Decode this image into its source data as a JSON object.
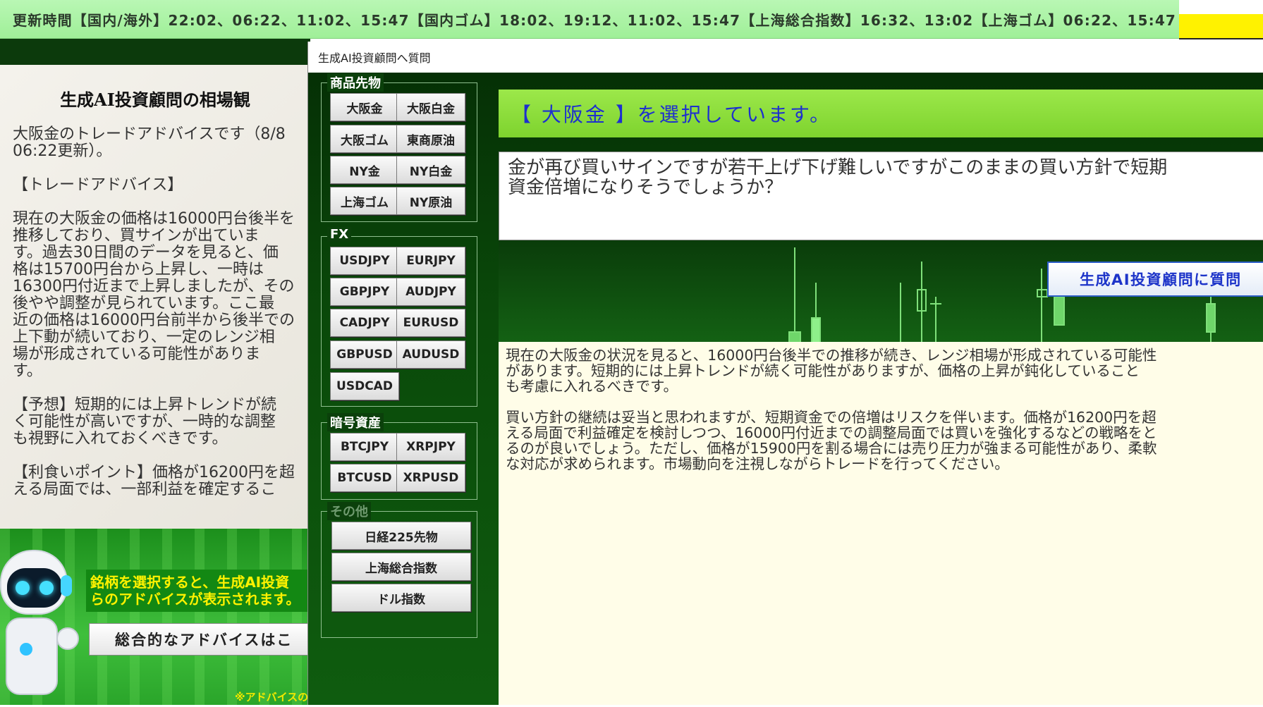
{
  "ticker": {
    "text": "更新時間【国内/海外】22:02、06:22、11:02、15:47【国内ゴム】18:02、19:12、11:02、15:47【上海総合指数】16:32、13:02【上海ゴム】06:22、15:47"
  },
  "left_panel": {
    "title": "生成AI投資顧問の相場観",
    "text": "大阪金のトレードアドバイスです（8/8\n06:22更新）。\n\n【トレードアドバイス】\n\n現在の大阪金の価格は16000円台後半を\n推移しており、買サインが出ていま\nす。過去30日間のデータを見ると、価\n格は15700円台から上昇し、一時は\n16300円付近まで上昇しましたが、その\n後やや調整が見られています。ここ最\n近の価格は16000円台前半から後半での\n上下動が続いており、一定のレンジ相\n場が形成されている可能性がありま\nす。\n\n【予想】短期的には上昇トレンドが続\nく可能性が高いですが、一時的な調整\nも視野に入れておくべきです。\n\n【利食いポイント】価格が16200円を超\nえる局面では、一部利益を確定するこ"
  },
  "left_bottom": {
    "message": "銘柄を選択すると、生成AI投資\nらのアドバイスが表示されます。",
    "summary_button": "総合的なアドバイスはこ",
    "note": "※アドバイスの"
  },
  "dialog": {
    "title": "生成AI投資顧問へ質問",
    "groups": [
      {
        "label": "商品先物",
        "buttons": [
          "大阪金",
          "大阪白金",
          "大阪ゴム",
          "東商原油",
          "NY金",
          "NY白金",
          "上海ゴム",
          "NY原油"
        ]
      },
      {
        "label": "FX",
        "buttons": [
          "USDJPY",
          "EURJPY",
          "GBPJPY",
          "AUDJPY",
          "CADJPY",
          "EURUSD",
          "GBPUSD",
          "AUDUSD",
          "USDCAD"
        ]
      },
      {
        "label": "暗号資産",
        "buttons": [
          "BTCJPY",
          "XRPJPY",
          "BTCUSD",
          "XRPUSD"
        ]
      },
      {
        "label": "その他",
        "buttons": [
          "日経225先物",
          "上海総合指数",
          "ドル指数"
        ]
      }
    ],
    "selected_banner": "【 大阪金 】を選択しています。",
    "question": "金が再び買いサインですが若干上げ下げ難しいですがこのままの買い方針で短期\n資金倍増になりそうでしょうか？",
    "ask_button": "生成AI投資顧問に質問",
    "answer": "現在の大阪金の状況を見ると、16000円台後半での推移が続き、レンジ相場が形成されている可能性\nがあります。短期的には上昇トレンドが続く可能性がありますが、価格の上昇が鈍化していること\nも考慮に入れるべきです。\n\n買い方針の継続は妥当と思われますが、短期資金での倍増はリスクを伴います。価格が16200円を超\nえる局面で利益確定を検討しつつ、16000円付近までの調整局面では買いを強化するなどの戦略をと\nるのが良いでしょう。ただし、価格が15900円を割る場合には売り圧力が強まる可能性があり、柔軟\nな対応が求められます。市場動向を注視しながらトレードを行ってください。"
  },
  "colors": {
    "ticker_bg": "#b9f7b4",
    "banner_bg": "#8fdc3c",
    "banner_text": "#1d2fcf",
    "answer_bg": "#fffde8",
    "message_text": "#fff200"
  }
}
